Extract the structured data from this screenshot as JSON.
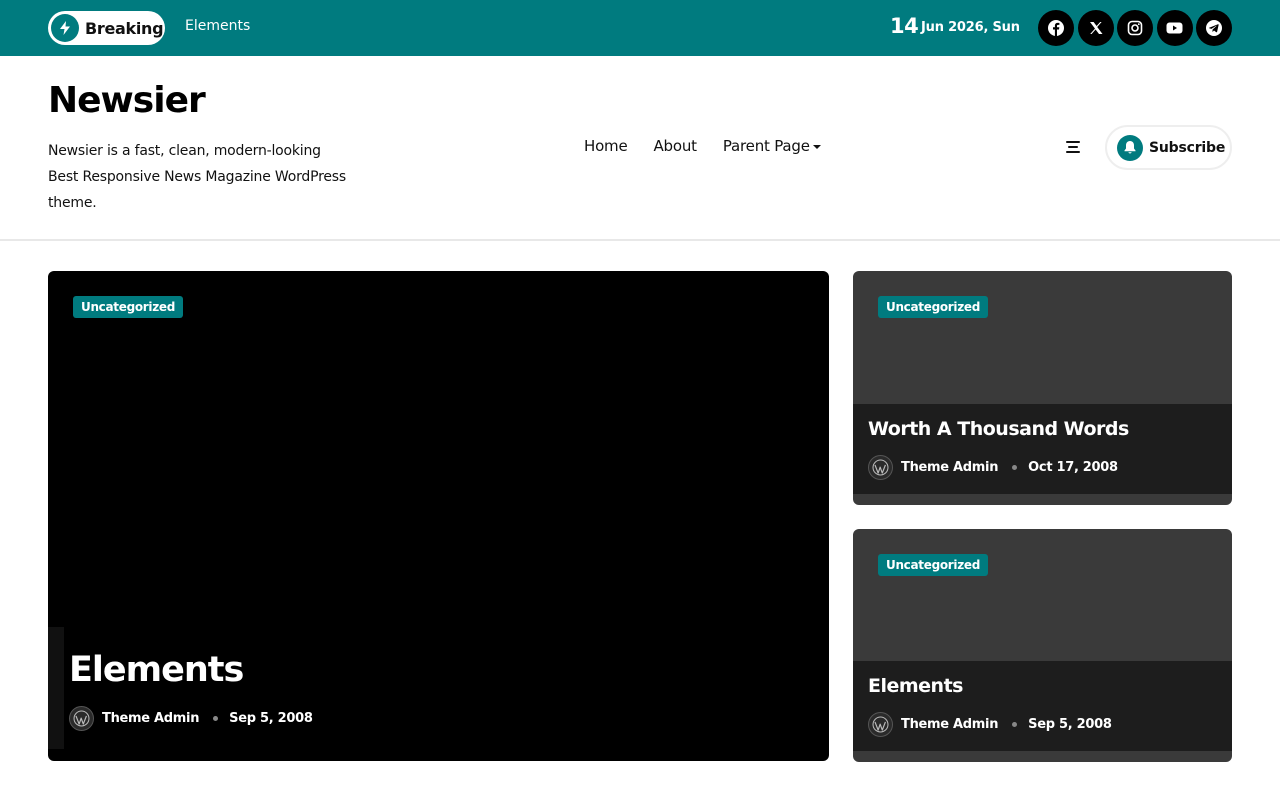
{
  "topbar": {
    "breaking_label": "Breaking",
    "ticker_text": "Elements",
    "date_day": "14",
    "date_rest": "Jun 2026, Sun",
    "social_icons": [
      "facebook-icon",
      "x-twitter-icon",
      "instagram-icon",
      "youtube-icon",
      "telegram-icon"
    ]
  },
  "header": {
    "site_title": "Newsier",
    "site_description": "Newsier is a fast, clean, modern-looking Best Responsive News Magazine WordPress theme.",
    "nav": {
      "home": "Home",
      "about": "About",
      "parent_page": "Parent Page"
    },
    "subscribe_label": "Subscribe"
  },
  "posts": {
    "featured": {
      "category": "Uncategorized",
      "title": "Elements",
      "author": "Theme Admin",
      "date": "Sep 5, 2008"
    },
    "side1": {
      "category": "Uncategorized",
      "title": "Worth A Thousand Words",
      "author": "Theme Admin",
      "date": "Oct 17, 2008"
    },
    "side2": {
      "category": "Uncategorized",
      "title": "Elements",
      "author": "Theme Admin",
      "date": "Sep 5, 2008"
    }
  },
  "colors": {
    "accent": "#007b7f",
    "dark_card": "#3a3a3a"
  }
}
